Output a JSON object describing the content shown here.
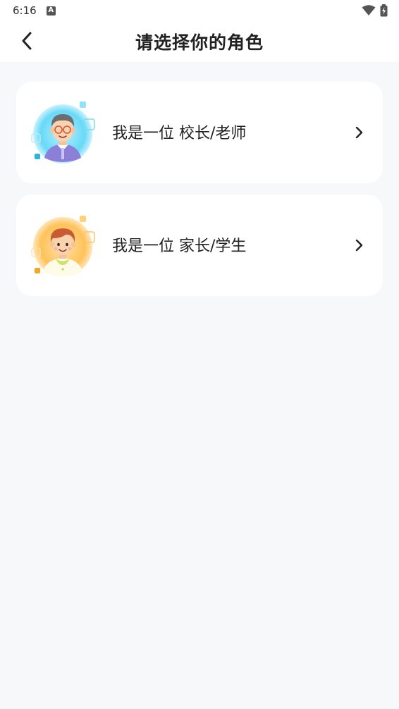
{
  "statusbar": {
    "time": "6:16",
    "notification_icon": "font-a-icon",
    "wifi_icon": "wifi-icon",
    "battery_icon": "battery-charging-icon"
  },
  "header": {
    "back_icon": "chevron-left-icon",
    "title": "请选择你的角色"
  },
  "roles": [
    {
      "label": "我是一位 校长/老师",
      "avatar": "teacher-avatar",
      "accent": "#5fd6f5",
      "arrow_icon": "chevron-right-icon"
    },
    {
      "label": "我是一位 家长/学生",
      "avatar": "student-avatar",
      "accent": "#ffc96b",
      "arrow_icon": "chevron-right-icon"
    }
  ],
  "colors": {
    "background": "#f7f8fa",
    "card": "#ffffff",
    "text": "#222222"
  }
}
